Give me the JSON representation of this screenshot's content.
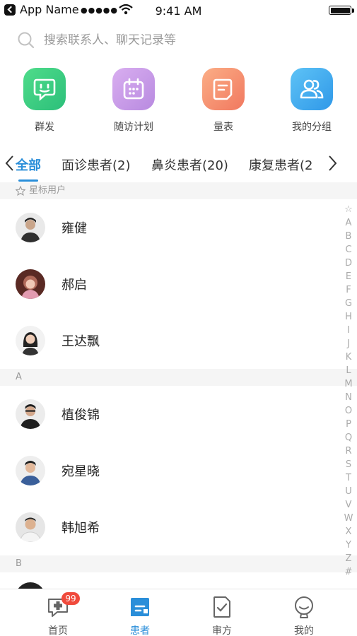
{
  "status_bar": {
    "app_name": "App Name",
    "signal": "●●●●●",
    "time": "9:41 AM"
  },
  "search": {
    "placeholder": "搜索联系人、聊天记录等"
  },
  "quick_actions": [
    {
      "label": "群发",
      "icon": "group-message-icon",
      "color": "#3cc983"
    },
    {
      "label": "随访计划",
      "icon": "calendar-icon",
      "color": "#c79be6"
    },
    {
      "label": "量表",
      "icon": "form-icon",
      "color": "#f5896f"
    },
    {
      "label": "我的分组",
      "icon": "people-icon",
      "color": "#3fa9ef"
    }
  ],
  "tabs": [
    {
      "label": "全部",
      "active": true
    },
    {
      "label": "面诊患者(2)"
    },
    {
      "label": "鼻炎患者(20)"
    },
    {
      "label": "康复患者(2"
    }
  ],
  "sections": [
    {
      "title": "星标用户",
      "starred": true,
      "rows": [
        {
          "name": "雍健"
        },
        {
          "name": "郝启"
        },
        {
          "name": "王达飘"
        }
      ]
    },
    {
      "title": "A",
      "rows": [
        {
          "name": "植俊锦"
        },
        {
          "name": "宛星晓"
        },
        {
          "name": "韩旭希"
        }
      ]
    },
    {
      "title": "B",
      "rows": []
    }
  ],
  "index_letters": [
    "☆",
    "A",
    "B",
    "C",
    "D",
    "E",
    "F",
    "G",
    "H",
    "I",
    "J",
    "K",
    "L",
    "M",
    "N",
    "O",
    "P",
    "Q",
    "R",
    "S",
    "T",
    "U",
    "V",
    "W",
    "X",
    "Y",
    "Z",
    "#"
  ],
  "tab_bar": [
    {
      "label": "首页",
      "icon": "home-medical-icon",
      "badge": "99"
    },
    {
      "label": "患者",
      "icon": "patient-icon",
      "active": true
    },
    {
      "label": "审方",
      "icon": "prescription-icon"
    },
    {
      "label": "我的",
      "icon": "profile-icon"
    }
  ],
  "colors": {
    "accent": "#2a8ed9",
    "badge": "#f04a3c"
  }
}
